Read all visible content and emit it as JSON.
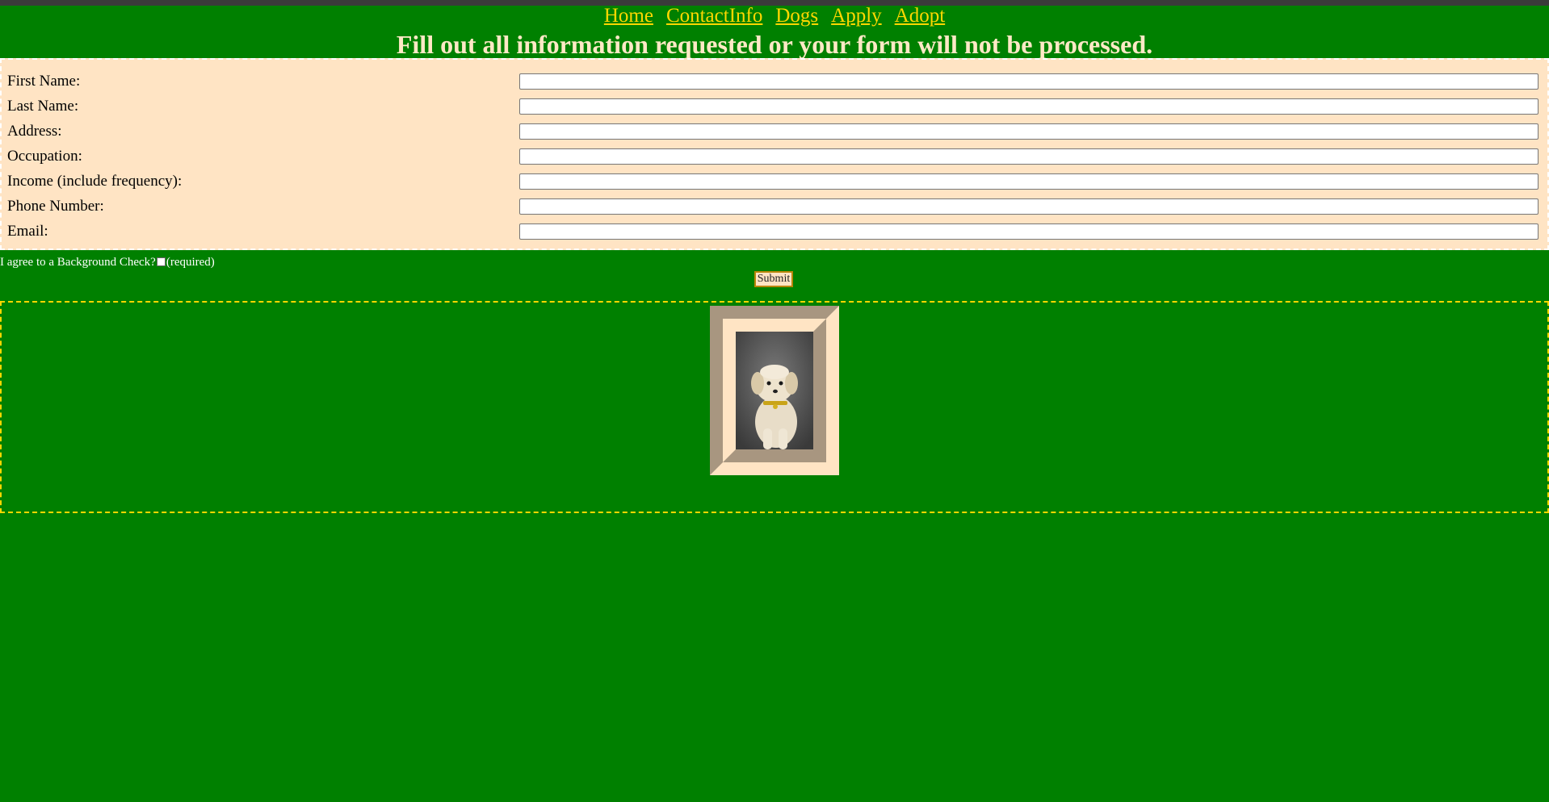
{
  "nav": {
    "links": [
      "Home",
      "ContactInfo",
      "Dogs",
      "Apply",
      "Adopt"
    ]
  },
  "headline": "Fill out all information requested or your form will not be processed.",
  "form": {
    "fields": [
      {
        "label": "First Name:",
        "value": ""
      },
      {
        "label": "Last Name:",
        "value": ""
      },
      {
        "label": "Address:",
        "value": ""
      },
      {
        "label": "Occupation:",
        "value": ""
      },
      {
        "label": "Income (include frequency):",
        "value": ""
      },
      {
        "label": "Phone Number:",
        "value": ""
      },
      {
        "label": "Email:",
        "value": ""
      }
    ],
    "agree_text": "I agree to a Background Check?",
    "agree_required": "(required)",
    "agree_checked": false,
    "submit_label": "Submit"
  },
  "colors": {
    "background": "#008000",
    "nav_link": "#ffd700",
    "headline": "#ffe9c6",
    "form_background": "#ffe4c4"
  },
  "gallery": {
    "image_icon": "dog-photo"
  }
}
